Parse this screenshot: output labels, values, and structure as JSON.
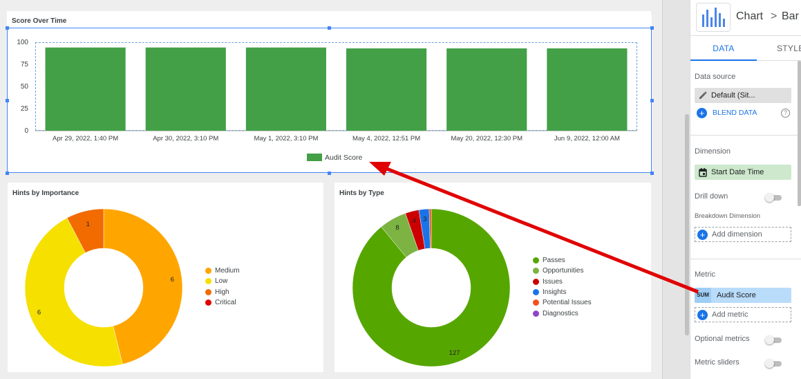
{
  "score_card": {
    "title": "Score Over Time",
    "chart_data": {
      "type": "bar",
      "categories": [
        "Apr 29, 2022, 1:40 PM",
        "Apr 30, 2022, 3:10 PM",
        "May 1, 2022, 3:10 PM",
        "May 4, 2022, 12:51 PM",
        "May 20, 2022, 12:30 PM",
        "Jun 9, 2022, 12:00 AM"
      ],
      "series": [
        {
          "name": "Audit Score",
          "values": [
            94,
            94,
            94,
            93,
            93,
            93
          ],
          "color": "#43a047"
        }
      ],
      "ylim": [
        0,
        100
      ],
      "yticks": [
        "100",
        "75",
        "50",
        "25",
        "0"
      ],
      "legend": "bottom-center",
      "grid": false
    }
  },
  "importance_card": {
    "title": "Hints by Importance",
    "chart_data": {
      "type": "pie",
      "donut": true,
      "slices": [
        {
          "name": "Medium",
          "value": 6,
          "color": "#ffa500"
        },
        {
          "name": "Low",
          "value": 6,
          "color": "#f5e000"
        },
        {
          "name": "High",
          "value": 1,
          "color": "#f26b00"
        },
        {
          "name": "Critical",
          "value": 0,
          "color": "#e00000"
        }
      ],
      "legend": "right"
    }
  },
  "type_card": {
    "title": "Hints by Type",
    "chart_data": {
      "type": "pie",
      "donut": true,
      "slices": [
        {
          "name": "Passes",
          "value": 127,
          "color": "#56a600"
        },
        {
          "name": "Opportunities",
          "value": 8,
          "color": "#7cb342"
        },
        {
          "name": "Issues",
          "value": 4,
          "color": "#cc0000"
        },
        {
          "name": "Insights",
          "value": 3,
          "color": "#1a73e8"
        },
        {
          "name": "Potential Issues",
          "value": 0.6,
          "color": "#f4511e"
        },
        {
          "name": "Diagnostics",
          "value": 0,
          "color": "#8e44c8"
        }
      ],
      "legend": "right"
    }
  },
  "panel": {
    "crumb_chart": "Chart",
    "crumb_sep": ">",
    "crumb_type": "Bar",
    "tab_data": "DATA",
    "tab_style": "STYLE",
    "data_source_label": "Data source",
    "data_source_value": "Default (Sit...",
    "blend_data": "BLEND DATA",
    "dimension_label": "Dimension",
    "dimension_value": "Start Date Time",
    "drill_down": "Drill down",
    "breakdown_label": "Breakdown Dimension",
    "add_dimension": "Add dimension",
    "metric_label": "Metric",
    "metric_agg": "SUM",
    "metric_value": "Audit Score",
    "add_metric": "Add metric",
    "optional_metrics": "Optional metrics",
    "metric_sliders": "Metric sliders",
    "accent": "#1a73e8"
  },
  "annotation": {
    "color": "#e00000"
  }
}
